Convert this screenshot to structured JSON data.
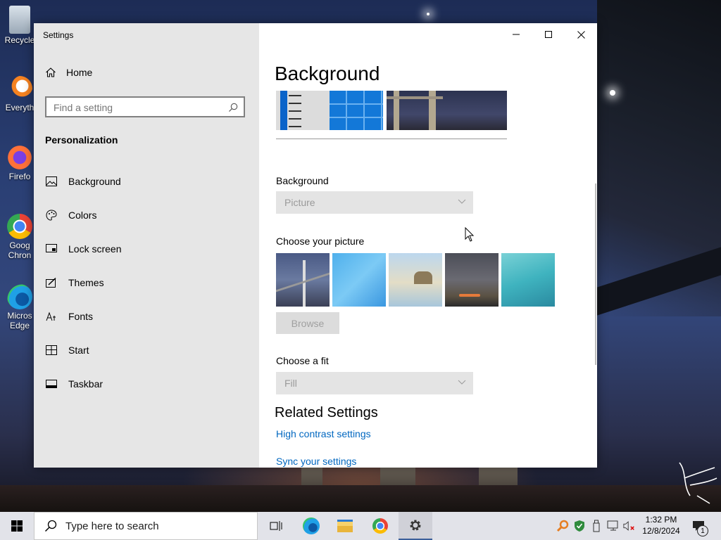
{
  "window": {
    "title": "Settings",
    "sidebar": {
      "home_label": "Home",
      "search_placeholder": "Find a setting",
      "section_title": "Personalization",
      "items": [
        {
          "label": "Background",
          "icon": "picture-icon"
        },
        {
          "label": "Colors",
          "icon": "palette-icon"
        },
        {
          "label": "Lock screen",
          "icon": "lock-screen-icon"
        },
        {
          "label": "Themes",
          "icon": "brush-icon"
        },
        {
          "label": "Fonts",
          "icon": "font-icon"
        },
        {
          "label": "Start",
          "icon": "start-icon"
        },
        {
          "label": "Taskbar",
          "icon": "taskbar-icon"
        }
      ]
    },
    "content": {
      "page_title": "Background",
      "background_label": "Background",
      "background_value": "Picture",
      "choose_picture_label": "Choose your picture",
      "browse_label": "Browse",
      "choose_fit_label": "Choose a fit",
      "fit_value": "Fill",
      "related_title": "Related Settings",
      "links": [
        "High contrast settings",
        "Sync your settings"
      ]
    }
  },
  "desktop_icons": [
    "Recycle",
    "Everyth",
    "Firefo",
    "Goog Chron",
    "Micros Edge"
  ],
  "taskbar": {
    "search_placeholder": "Type here to search",
    "time": "1:32 PM",
    "date": "12/8/2024",
    "notification_count": "1"
  },
  "colors": {
    "accent": "#0078d7",
    "link": "#0067c0",
    "sidebar_bg": "#e6e6e6",
    "taskbar_bg": "#e2e3e9"
  }
}
